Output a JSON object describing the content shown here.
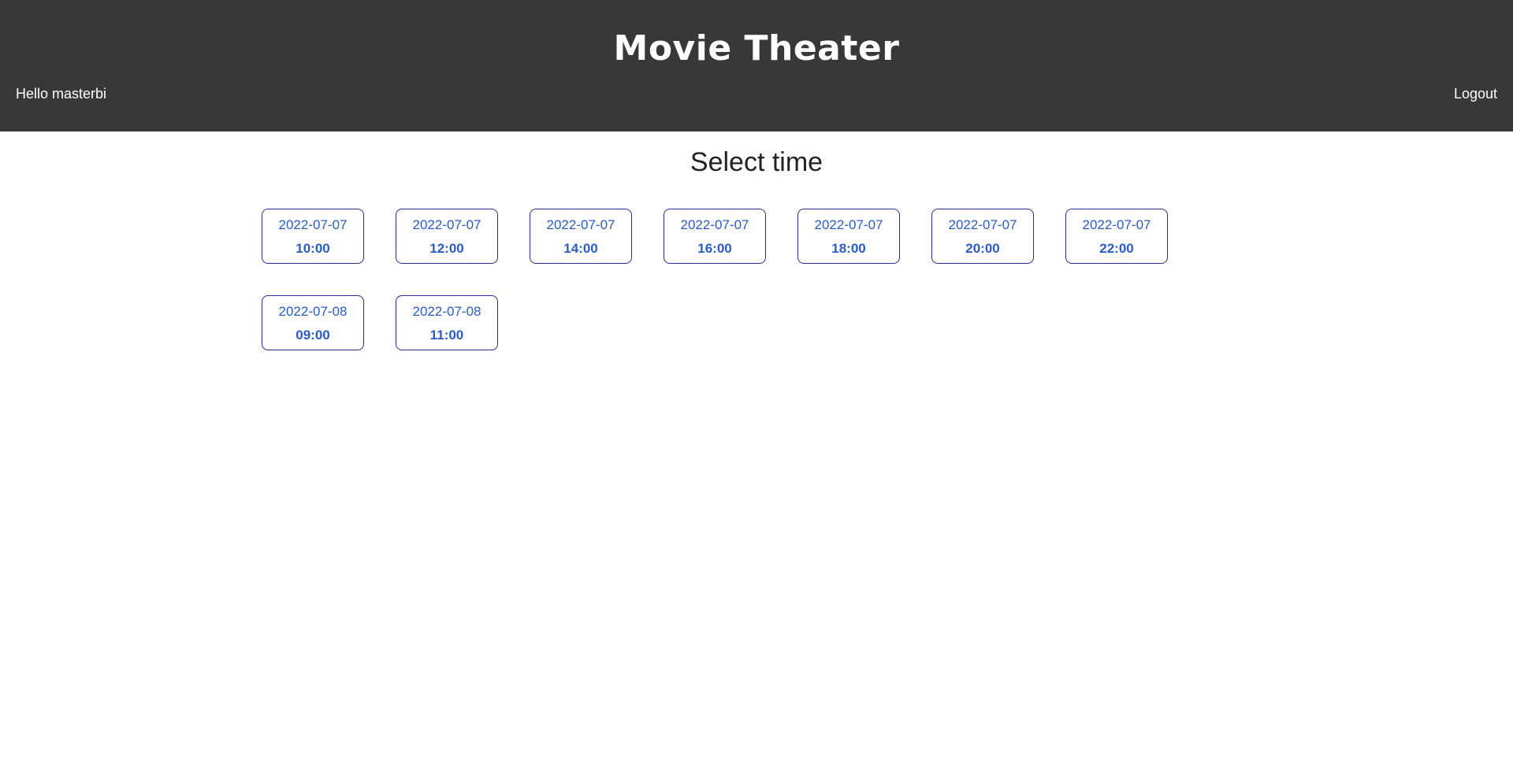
{
  "header": {
    "title": "Movie Theater",
    "greeting": "Hello masterbi",
    "logout_label": "Logout"
  },
  "main": {
    "heading": "Select time",
    "showtimes": [
      {
        "date": "2022-07-07",
        "time": "10:00"
      },
      {
        "date": "2022-07-07",
        "time": "12:00"
      },
      {
        "date": "2022-07-07",
        "time": "14:00"
      },
      {
        "date": "2022-07-07",
        "time": "16:00"
      },
      {
        "date": "2022-07-07",
        "time": "18:00"
      },
      {
        "date": "2022-07-07",
        "time": "20:00"
      },
      {
        "date": "2022-07-07",
        "time": "22:00"
      },
      {
        "date": "2022-07-08",
        "time": "09:00"
      },
      {
        "date": "2022-07-08",
        "time": "11:00"
      }
    ]
  },
  "colors": {
    "header_bg": "#383838",
    "slot_border": "#2a2a9a",
    "slot_text": "#2a5bc8"
  }
}
